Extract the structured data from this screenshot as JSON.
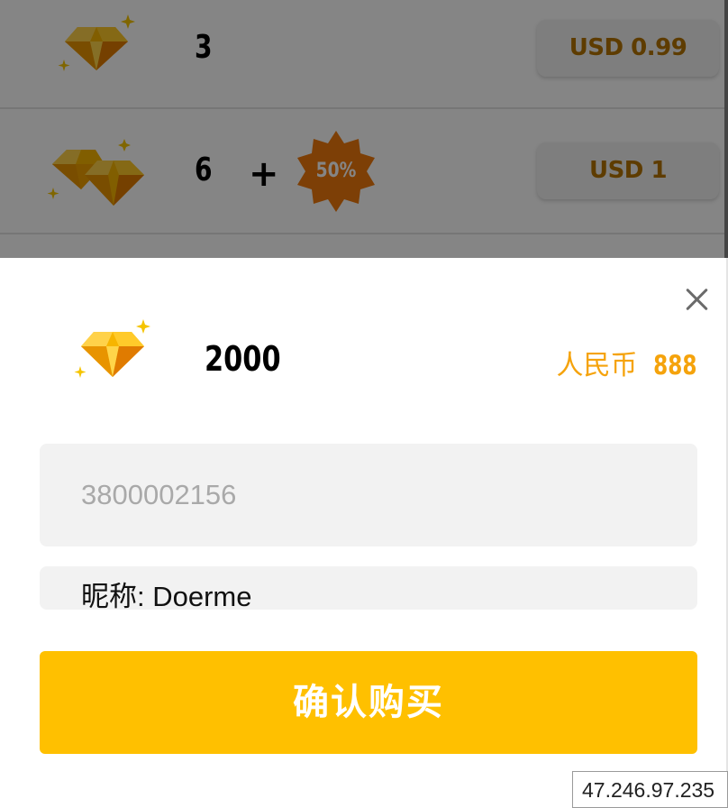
{
  "store": {
    "rows": [
      {
        "quantity": "3",
        "price": "USD 0.99"
      },
      {
        "quantity": "6",
        "plus": "+",
        "bonus": "50%",
        "price": "USD 1"
      }
    ]
  },
  "sheet": {
    "quantity": "2000",
    "currency_label": "人民币",
    "currency_amount": "888",
    "player_id_placeholder": "3800002156",
    "player_id_value": "",
    "nickname_text": "昵称: Doerme",
    "confirm_label": "确认购买"
  },
  "footer": {
    "ip_address": "47.246.97.235"
  },
  "colors": {
    "accent_yellow": "#ffc000",
    "price_orange": "#f5a30c",
    "price_text_brown": "#b47300",
    "badge_orange": "#f07a0c"
  },
  "icons": {
    "gem": "diamond-gem-icon",
    "close": "close-icon",
    "badge": "starburst-badge-icon"
  }
}
